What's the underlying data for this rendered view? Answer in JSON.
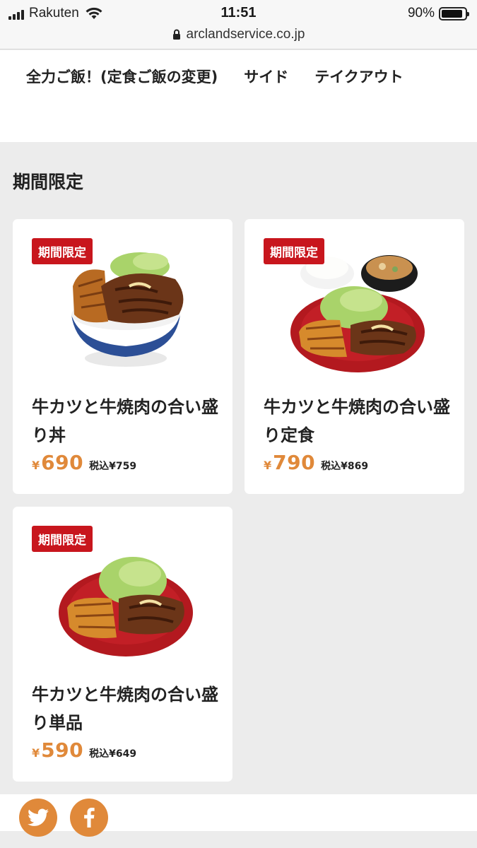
{
  "status_bar": {
    "carrier": "Rakuten",
    "time": "11:51",
    "battery": "90%",
    "battery_level": 0.9,
    "url": "arclandservice.co.jp"
  },
  "nav": {
    "items": [
      {
        "label": "全力ご飯！(定食ご飯の変更)"
      },
      {
        "label": "サイド"
      },
      {
        "label": "テイクアウト"
      }
    ]
  },
  "section": {
    "title": "期間限定"
  },
  "products": [
    {
      "badge": "期間限定",
      "name": "牛カツと牛焼肉の合い盛り丼",
      "currency": "¥",
      "price": "690",
      "tax_price": "税込¥759",
      "image_icon": "gyukatsu-don-bowl-icon"
    },
    {
      "badge": "期間限定",
      "name": "牛カツと牛焼肉の合い盛り定食",
      "currency": "¥",
      "price": "790",
      "tax_price": "税込¥869",
      "image_icon": "gyukatsu-teishoku-set-icon"
    },
    {
      "badge": "期間限定",
      "name": "牛カツと牛焼肉の合い盛り単品",
      "currency": "¥",
      "price": "590",
      "tax_price": "税込¥649",
      "image_icon": "gyukatsu-plate-icon"
    }
  ],
  "colors": {
    "accent": "#e0893a",
    "badge": "#c8161d",
    "plate_red": "#b3191f",
    "bowl_blue": "#2c4f96"
  },
  "social": [
    {
      "icon": "twitter-icon"
    },
    {
      "icon": "facebook-icon"
    }
  ]
}
